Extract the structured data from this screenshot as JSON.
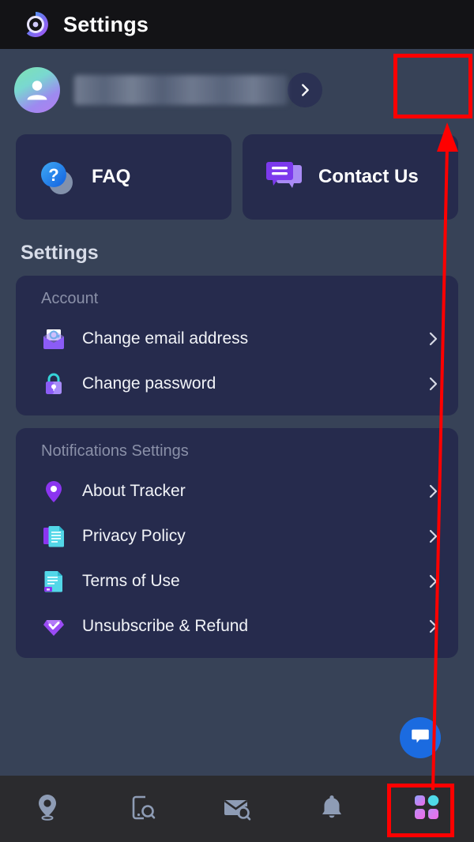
{
  "header": {
    "title": "Settings",
    "logo_icon": "app-logo-icon"
  },
  "profile": {
    "avatar_icon": "person-avatar-icon",
    "name": "",
    "name_state": "redacted",
    "chevron_icon": "chevron-right-icon"
  },
  "quick_actions": [
    {
      "label": "FAQ",
      "icon": "question-mark-circle-icon"
    },
    {
      "label": "Contact Us",
      "icon": "chat-bubbles-icon"
    }
  ],
  "settings": {
    "title": "Settings",
    "groups": [
      {
        "label": "Account",
        "items": [
          {
            "label": "Change email address",
            "icon": "envelope-at-icon",
            "chevron": "chevron-right-icon"
          },
          {
            "label": "Change password",
            "icon": "padlock-icon",
            "chevron": "chevron-right-icon"
          }
        ]
      },
      {
        "label": "Notifications Settings",
        "items": [
          {
            "label": "About Tracker",
            "icon": "map-pin-icon",
            "chevron": "chevron-right-icon"
          },
          {
            "label": "Privacy Policy",
            "icon": "privacy-document-icon",
            "chevron": "chevron-right-icon"
          },
          {
            "label": "Terms of Use",
            "icon": "terms-document-icon",
            "chevron": "chevron-right-icon"
          },
          {
            "label": "Unsubscribe & Refund",
            "icon": "diamond-check-icon",
            "chevron": "chevron-right-icon"
          }
        ]
      }
    ]
  },
  "floating_action": {
    "icon": "chat-bubble-icon",
    "color": "#1B6BE0"
  },
  "bottom_nav": {
    "items": [
      {
        "name": "location",
        "icon": "location-pin-icon",
        "active": false
      },
      {
        "name": "device-search",
        "icon": "phone-search-icon",
        "active": false
      },
      {
        "name": "mail-search",
        "icon": "mail-search-icon",
        "active": false
      },
      {
        "name": "alerts",
        "icon": "bell-icon",
        "active": false
      },
      {
        "name": "more",
        "icon": "grid-apps-icon",
        "active": true
      }
    ]
  },
  "annotations": {
    "color": "#FF0000",
    "boxes": [
      {
        "target": "profile-chevron"
      },
      {
        "target": "nav-more"
      }
    ],
    "arrow": {
      "from": "nav-more",
      "to": "profile-chevron"
    }
  },
  "colors": {
    "page_background": "#374257",
    "header_background": "#131316",
    "card_background": "#262B4D",
    "nav_background": "#2B2B2E",
    "accent_purple": "#8B5CF6",
    "accent_cyan": "#3DD6E0",
    "text_primary": "#F2F4F8",
    "text_muted": "#8A90A8",
    "annotation_red": "#FF0000"
  }
}
